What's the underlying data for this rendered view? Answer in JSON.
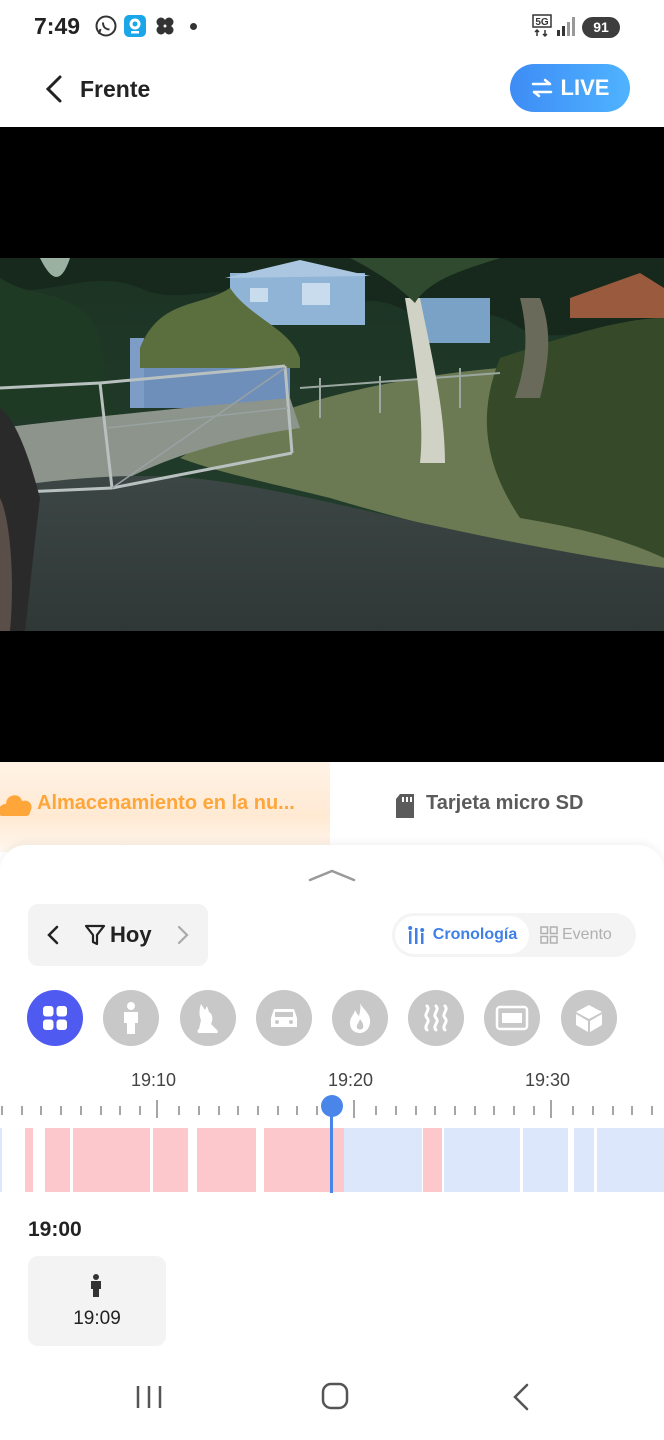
{
  "status_bar": {
    "time": "7:49",
    "network": "5G",
    "battery": "91"
  },
  "header": {
    "title": "Frente",
    "live_label": "LIVE"
  },
  "storage_tabs": {
    "cloud_label": "Almacenamiento en la nu...",
    "sd_label": "Tarjeta micro SD"
  },
  "date_picker": {
    "label": "Hoy"
  },
  "view_toggle": {
    "timeline_label": "Cronología",
    "event_label": "Evento"
  },
  "filters": [
    {
      "icon": "all-grid-icon",
      "active": true
    },
    {
      "icon": "person-icon",
      "active": false
    },
    {
      "icon": "pet-icon",
      "active": false
    },
    {
      "icon": "vehicle-icon",
      "active": false
    },
    {
      "icon": "fire-icon",
      "active": false
    },
    {
      "icon": "heat-icon",
      "active": false
    },
    {
      "icon": "license-plate-icon",
      "active": false
    },
    {
      "icon": "package-icon",
      "active": false
    }
  ],
  "timeline": {
    "labels": [
      "19:10",
      "19:20",
      "19:30"
    ],
    "colors": {
      "motion": "#fcc8cb",
      "recording": "#dce7fb",
      "cursor": "#4a86ea"
    }
  },
  "events": {
    "hour_label": "19:00",
    "items": [
      {
        "type": "person",
        "time": "19:09"
      }
    ]
  },
  "colors": {
    "accent": "#4f5af0",
    "live": "#3e8cf5",
    "cloud": "#ffa63b"
  }
}
